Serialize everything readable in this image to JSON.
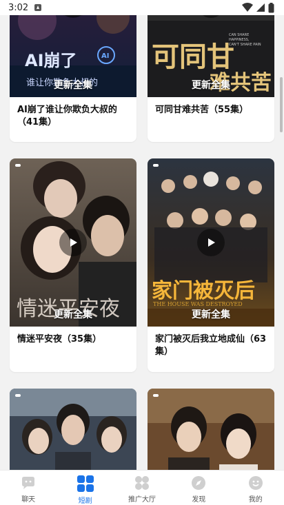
{
  "status_bar": {
    "time": "3:02",
    "notification_icon": "app-notification-icon",
    "wifi_icon": "wifi-icon",
    "signal_icon": "cell-signal-icon",
    "battery_icon": "battery-icon"
  },
  "feed": {
    "cards": [
      {
        "title": "AI崩了谁让你欺负大叔的（41集）",
        "badge": "更新全集",
        "poster_text": "AI崩了",
        "poster_sub": "谁让你欺负大叔的"
      },
      {
        "title": "可同甘难共苦（55集）",
        "badge": "更新全集",
        "poster_text": "可同甘",
        "poster_sub": "CAN SHARE HAPPINESS, CAN'T SHARE PAIN"
      },
      {
        "title": "情迷平安夜（35集）",
        "badge": "更新全集",
        "poster_text": "情迷平安夜"
      },
      {
        "title": "家门被灭后我立地成仙（63集）",
        "badge": "更新全集",
        "poster_text": "家门被灭后",
        "poster_sub": "THE HOUSE WAS DESTROYED"
      },
      {
        "title": "",
        "badge": ""
      },
      {
        "title": "",
        "badge": ""
      }
    ]
  },
  "tabbar": {
    "tabs": [
      {
        "label": "聊天",
        "icon": "chat-icon",
        "active": false
      },
      {
        "label": "短剧",
        "icon": "short-drama-grid-icon",
        "active": true
      },
      {
        "label": "推广大厅",
        "icon": "promotion-hall-icon",
        "active": false
      },
      {
        "label": "发现",
        "icon": "discover-compass-icon",
        "active": false
      },
      {
        "label": "我的",
        "icon": "profile-icon",
        "active": false
      }
    ]
  },
  "colors": {
    "accent": "#1a73e8",
    "inactive": "#c8c8c8"
  }
}
